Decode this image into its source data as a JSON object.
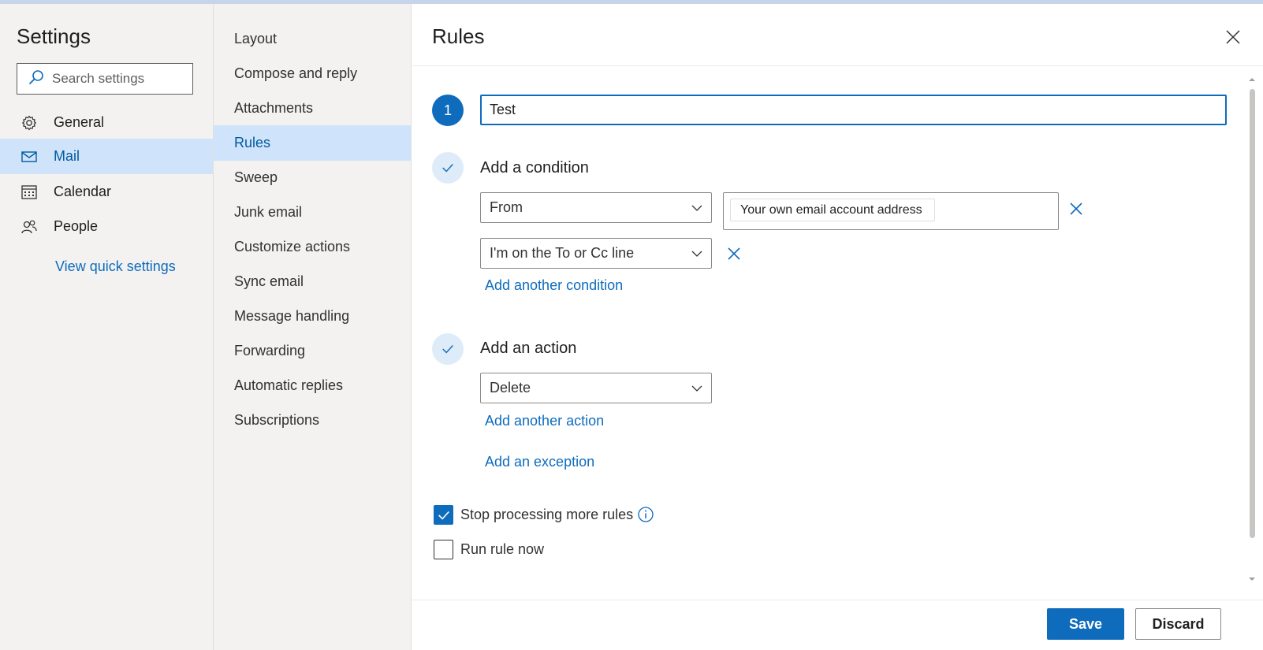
{
  "nav": {
    "title": "Settings",
    "search_placeholder": "Search settings",
    "items": [
      {
        "label": "General",
        "icon": "gear-icon"
      },
      {
        "label": "Mail",
        "icon": "mail-icon",
        "active": true
      },
      {
        "label": "Calendar",
        "icon": "calendar-icon"
      },
      {
        "label": "People",
        "icon": "people-icon"
      }
    ],
    "quick_settings": "View quick settings"
  },
  "mail_settings": {
    "items": [
      "Layout",
      "Compose and reply",
      "Attachments",
      "Rules",
      "Sweep",
      "Junk email",
      "Customize actions",
      "Sync email",
      "Message handling",
      "Forwarding",
      "Automatic replies",
      "Subscriptions"
    ],
    "active": "Rules"
  },
  "panel": {
    "title": "Rules",
    "step1_number": "1",
    "rule_name": "Test",
    "condition_title": "Add a condition",
    "conditions": [
      {
        "field": "From",
        "value": "Your own email account address"
      },
      {
        "field": "I'm on the To or Cc line"
      }
    ],
    "add_condition": "Add another condition",
    "action_title": "Add an action",
    "action": "Delete",
    "add_action": "Add another action",
    "add_exception": "Add an exception",
    "stop_processing": {
      "label": "Stop processing more rules",
      "checked": true
    },
    "run_now": {
      "label": "Run rule now",
      "checked": false
    },
    "save": "Save",
    "discard": "Discard"
  },
  "colors": {
    "accent": "#0f6cbd",
    "selected_bg": "#cfe4fa",
    "nav_bg": "#f3f2f1"
  }
}
